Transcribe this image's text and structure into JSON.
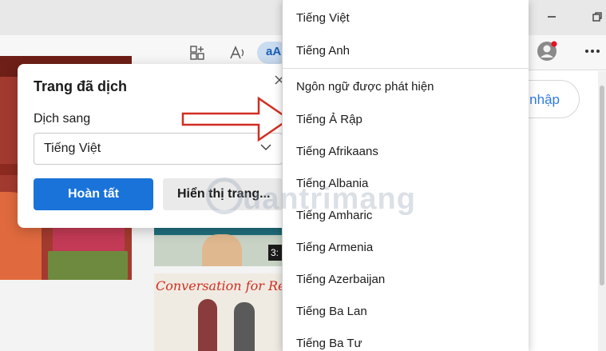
{
  "toolbar": {
    "translate_badge": "aA"
  },
  "page": {
    "login_label": "g nhập",
    "thumbnail_caption": "Conversation for Re",
    "video_time": "3:"
  },
  "translate_popup": {
    "title": "Trang đã dịch",
    "label": "Dịch sang",
    "selected_language": "Tiếng Việt",
    "done_button": "Hoàn tất",
    "show_button": "Hiển thị trang..."
  },
  "dropdown": {
    "items": [
      "Tiếng Việt",
      "Tiếng Anh",
      "Ngôn ngữ được phát hiện",
      "Tiếng Ả Rập",
      "Tiếng Afrikaans",
      "Tiếng Albania",
      "Tiếng Amharic",
      "Tiếng Armenia",
      "Tiếng Azerbaijan",
      "Tiếng Ba Lan",
      "Tiếng Ba Tư"
    ]
  },
  "watermark": {
    "text": "uantrimang"
  },
  "colors": {
    "accent": "#1a73d9",
    "arrow": "#d22d22",
    "profile_dot": "#e81123"
  }
}
